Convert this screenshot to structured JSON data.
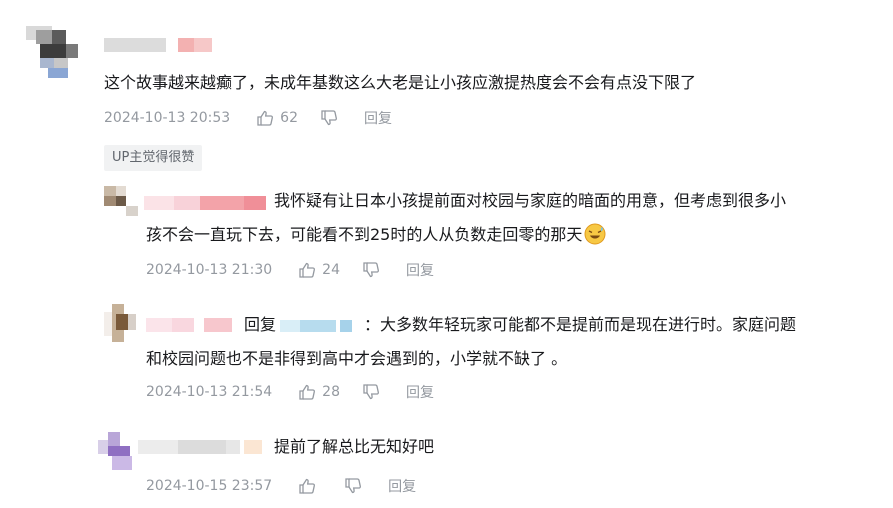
{
  "main_comment": {
    "content": "这个故事越来越癫了，未成年基数这么大老是让小孩应激提热度会不会有点没下限了",
    "time": "2024-10-13 20:53",
    "likes": "62",
    "reply_label": "回复",
    "up_tag": "UP主觉得很赞"
  },
  "replies": [
    {
      "content_line1": "我怀疑有让日本小孩提前面对校园与家庭的暗面的用意，但考虑到很多小",
      "content_line2": "孩不会一直玩下去，可能看不到25时的人从负数走回零的那天",
      "time": "2024-10-13 21:30",
      "likes": "24",
      "reply_label": "回复"
    },
    {
      "reply_prefix": "回复",
      "content_line1": "：大多数年轻玩家可能都不是提前而是现在进行时。家庭问题",
      "content_line2": "和校园问题也不是非得到高中才会遇到的，小学就不缺了 。",
      "time": "2024-10-13 21:54",
      "likes": "28",
      "reply_label": "回复"
    },
    {
      "content_line1": "提前了解总比无知好吧",
      "time": "2024-10-15 23:57",
      "likes": "",
      "reply_label": "回复"
    }
  ],
  "icons": {
    "like": "thumbs-up-icon",
    "dislike": "thumbs-down-icon",
    "emoji": "sweat-laugh-emoji"
  }
}
